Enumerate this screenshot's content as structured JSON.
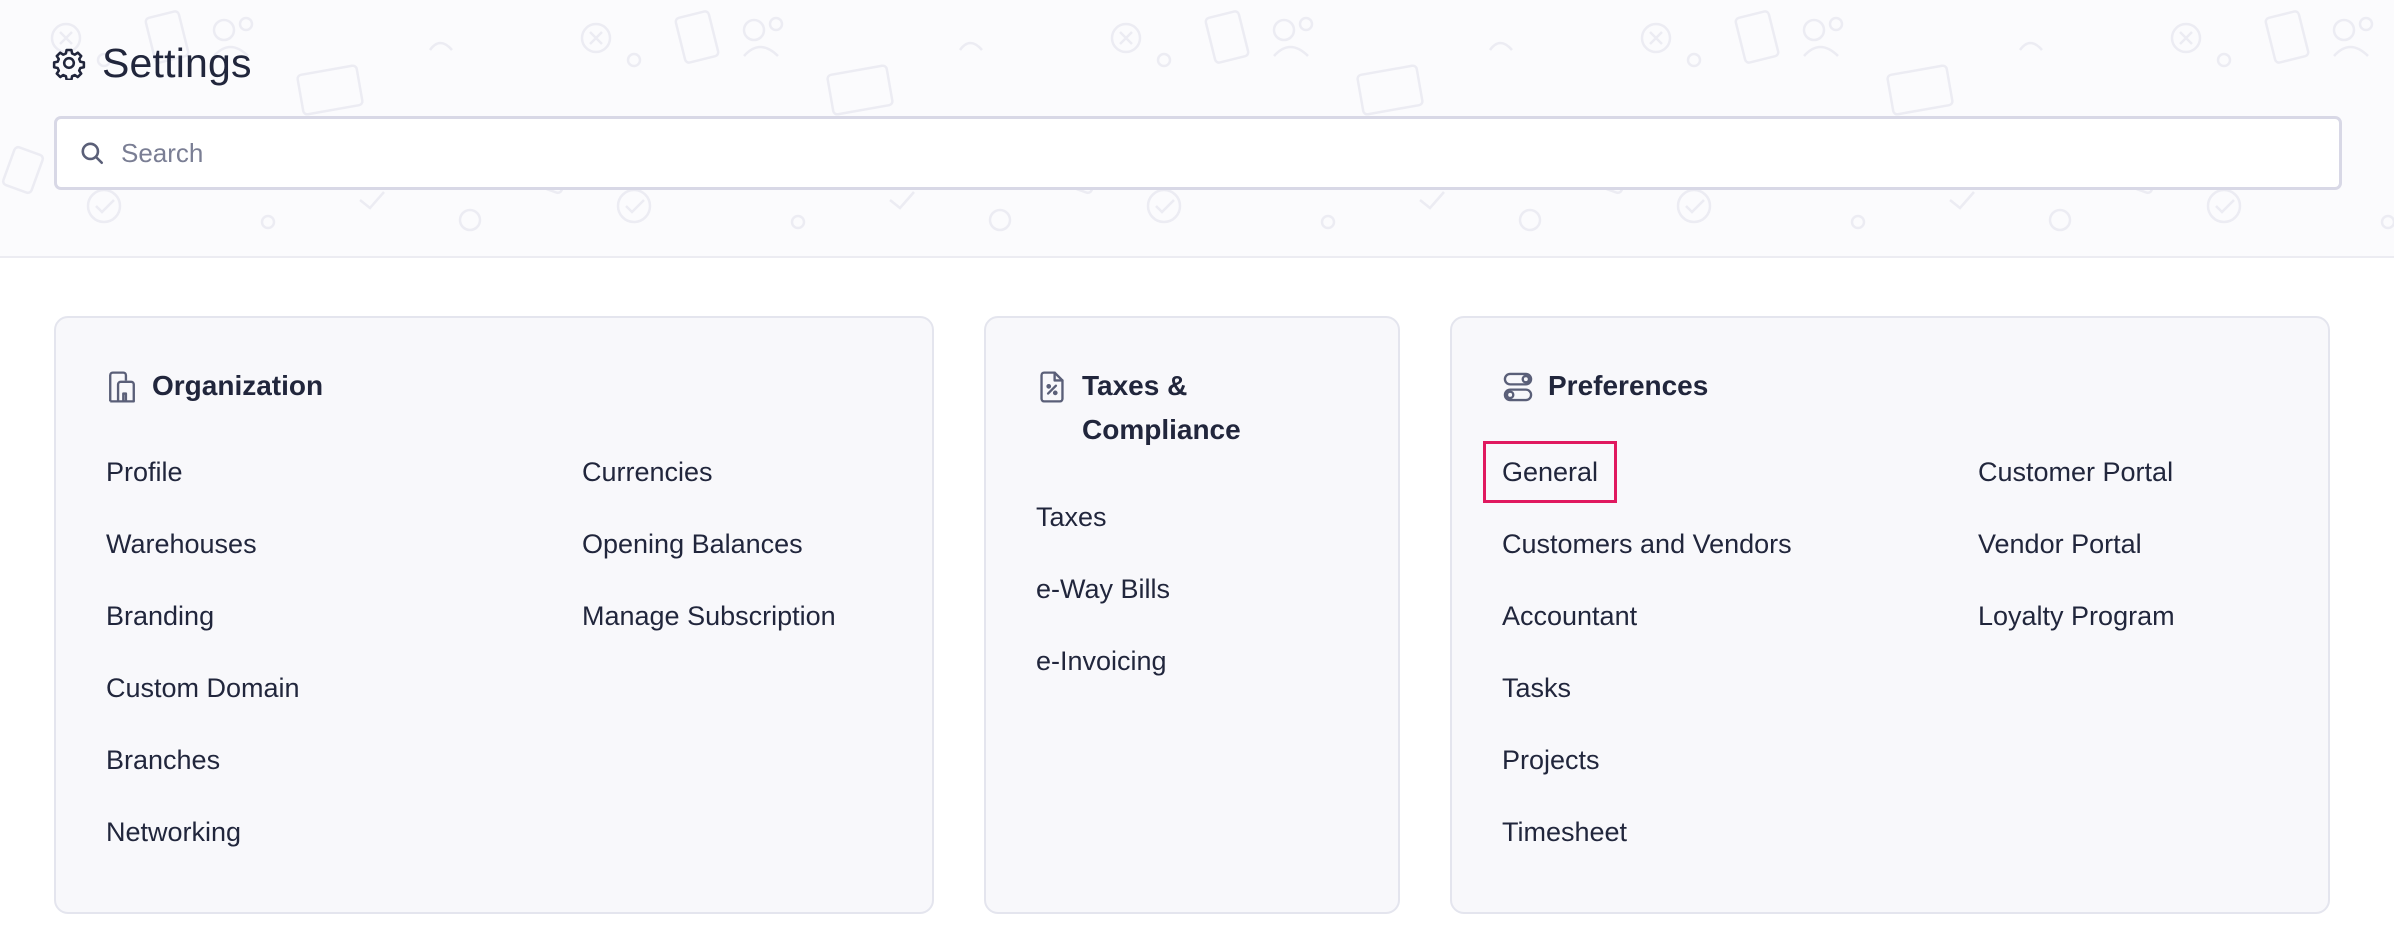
{
  "page": {
    "title": "Settings",
    "gear_icon": "gear-icon"
  },
  "search": {
    "placeholder": "Search",
    "value": "",
    "icon": "search-icon"
  },
  "colors": {
    "selected_outline": "#e0195f",
    "card_background": "#f8f8fb",
    "text": "#21263c"
  },
  "organization": {
    "title": "Organization",
    "icon": "building-icon",
    "col1": [
      "Profile",
      "Warehouses",
      "Branding",
      "Custom Domain",
      "Branches",
      "Networking"
    ],
    "col2": [
      "Currencies",
      "Opening Balances",
      "Manage Subscription"
    ]
  },
  "taxes": {
    "title": "Taxes & Compliance",
    "icon": "tax-document-icon",
    "items": [
      "Taxes",
      "e-Way Bills",
      "e-Invoicing"
    ]
  },
  "preferences": {
    "title": "Preferences",
    "icon": "toggles-icon",
    "col1": [
      "General",
      "Customers and Vendors",
      "Accountant",
      "Tasks",
      "Projects",
      "Timesheet"
    ],
    "col2": [
      "Customer Portal",
      "Vendor Portal",
      "Loyalty Program"
    ],
    "selected": "General"
  }
}
